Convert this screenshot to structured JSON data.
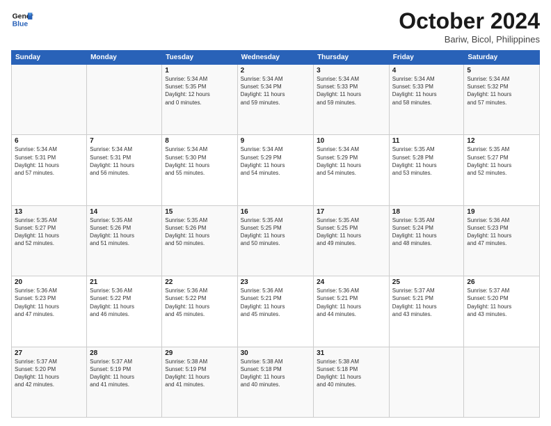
{
  "logo": {
    "line1": "General",
    "line2": "Blue"
  },
  "header": {
    "month": "October 2024",
    "location": "Bariw, Bicol, Philippines"
  },
  "weekdays": [
    "Sunday",
    "Monday",
    "Tuesday",
    "Wednesday",
    "Thursday",
    "Friday",
    "Saturday"
  ],
  "weeks": [
    [
      {
        "day": "",
        "info": ""
      },
      {
        "day": "",
        "info": ""
      },
      {
        "day": "1",
        "info": "Sunrise: 5:34 AM\nSunset: 5:35 PM\nDaylight: 12 hours\nand 0 minutes."
      },
      {
        "day": "2",
        "info": "Sunrise: 5:34 AM\nSunset: 5:34 PM\nDaylight: 11 hours\nand 59 minutes."
      },
      {
        "day": "3",
        "info": "Sunrise: 5:34 AM\nSunset: 5:33 PM\nDaylight: 11 hours\nand 59 minutes."
      },
      {
        "day": "4",
        "info": "Sunrise: 5:34 AM\nSunset: 5:33 PM\nDaylight: 11 hours\nand 58 minutes."
      },
      {
        "day": "5",
        "info": "Sunrise: 5:34 AM\nSunset: 5:32 PM\nDaylight: 11 hours\nand 57 minutes."
      }
    ],
    [
      {
        "day": "6",
        "info": "Sunrise: 5:34 AM\nSunset: 5:31 PM\nDaylight: 11 hours\nand 57 minutes."
      },
      {
        "day": "7",
        "info": "Sunrise: 5:34 AM\nSunset: 5:31 PM\nDaylight: 11 hours\nand 56 minutes."
      },
      {
        "day": "8",
        "info": "Sunrise: 5:34 AM\nSunset: 5:30 PM\nDaylight: 11 hours\nand 55 minutes."
      },
      {
        "day": "9",
        "info": "Sunrise: 5:34 AM\nSunset: 5:29 PM\nDaylight: 11 hours\nand 54 minutes."
      },
      {
        "day": "10",
        "info": "Sunrise: 5:34 AM\nSunset: 5:29 PM\nDaylight: 11 hours\nand 54 minutes."
      },
      {
        "day": "11",
        "info": "Sunrise: 5:35 AM\nSunset: 5:28 PM\nDaylight: 11 hours\nand 53 minutes."
      },
      {
        "day": "12",
        "info": "Sunrise: 5:35 AM\nSunset: 5:27 PM\nDaylight: 11 hours\nand 52 minutes."
      }
    ],
    [
      {
        "day": "13",
        "info": "Sunrise: 5:35 AM\nSunset: 5:27 PM\nDaylight: 11 hours\nand 52 minutes."
      },
      {
        "day": "14",
        "info": "Sunrise: 5:35 AM\nSunset: 5:26 PM\nDaylight: 11 hours\nand 51 minutes."
      },
      {
        "day": "15",
        "info": "Sunrise: 5:35 AM\nSunset: 5:26 PM\nDaylight: 11 hours\nand 50 minutes."
      },
      {
        "day": "16",
        "info": "Sunrise: 5:35 AM\nSunset: 5:25 PM\nDaylight: 11 hours\nand 50 minutes."
      },
      {
        "day": "17",
        "info": "Sunrise: 5:35 AM\nSunset: 5:25 PM\nDaylight: 11 hours\nand 49 minutes."
      },
      {
        "day": "18",
        "info": "Sunrise: 5:35 AM\nSunset: 5:24 PM\nDaylight: 11 hours\nand 48 minutes."
      },
      {
        "day": "19",
        "info": "Sunrise: 5:36 AM\nSunset: 5:23 PM\nDaylight: 11 hours\nand 47 minutes."
      }
    ],
    [
      {
        "day": "20",
        "info": "Sunrise: 5:36 AM\nSunset: 5:23 PM\nDaylight: 11 hours\nand 47 minutes."
      },
      {
        "day": "21",
        "info": "Sunrise: 5:36 AM\nSunset: 5:22 PM\nDaylight: 11 hours\nand 46 minutes."
      },
      {
        "day": "22",
        "info": "Sunrise: 5:36 AM\nSunset: 5:22 PM\nDaylight: 11 hours\nand 45 minutes."
      },
      {
        "day": "23",
        "info": "Sunrise: 5:36 AM\nSunset: 5:21 PM\nDaylight: 11 hours\nand 45 minutes."
      },
      {
        "day": "24",
        "info": "Sunrise: 5:36 AM\nSunset: 5:21 PM\nDaylight: 11 hours\nand 44 minutes."
      },
      {
        "day": "25",
        "info": "Sunrise: 5:37 AM\nSunset: 5:21 PM\nDaylight: 11 hours\nand 43 minutes."
      },
      {
        "day": "26",
        "info": "Sunrise: 5:37 AM\nSunset: 5:20 PM\nDaylight: 11 hours\nand 43 minutes."
      }
    ],
    [
      {
        "day": "27",
        "info": "Sunrise: 5:37 AM\nSunset: 5:20 PM\nDaylight: 11 hours\nand 42 minutes."
      },
      {
        "day": "28",
        "info": "Sunrise: 5:37 AM\nSunset: 5:19 PM\nDaylight: 11 hours\nand 41 minutes."
      },
      {
        "day": "29",
        "info": "Sunrise: 5:38 AM\nSunset: 5:19 PM\nDaylight: 11 hours\nand 41 minutes."
      },
      {
        "day": "30",
        "info": "Sunrise: 5:38 AM\nSunset: 5:18 PM\nDaylight: 11 hours\nand 40 minutes."
      },
      {
        "day": "31",
        "info": "Sunrise: 5:38 AM\nSunset: 5:18 PM\nDaylight: 11 hours\nand 40 minutes."
      },
      {
        "day": "",
        "info": ""
      },
      {
        "day": "",
        "info": ""
      }
    ]
  ]
}
